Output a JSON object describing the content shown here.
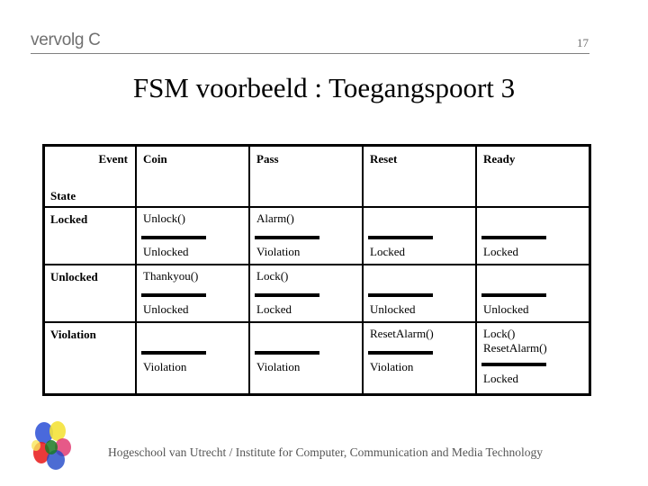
{
  "header": {
    "section": "vervolg C",
    "page_number": "17"
  },
  "title": "FSM voorbeeld : Toegangspoort 3",
  "table": {
    "corner": {
      "event_label": "Event",
      "state_label": "State"
    },
    "events": [
      "Coin",
      "Pass",
      "Reset",
      "Ready"
    ],
    "rows": [
      {
        "state": "Locked",
        "cells": [
          {
            "actions": [
              "Unlock()"
            ],
            "next": "Unlocked"
          },
          {
            "actions": [
              "Alarm()"
            ],
            "next": "Violation"
          },
          {
            "actions": [],
            "next": "Locked"
          },
          {
            "actions": [],
            "next": "Locked"
          }
        ]
      },
      {
        "state": "Unlocked",
        "cells": [
          {
            "actions": [
              "Thankyou()"
            ],
            "next": "Unlocked"
          },
          {
            "actions": [
              "Lock()"
            ],
            "next": "Locked"
          },
          {
            "actions": [],
            "next": "Unlocked"
          },
          {
            "actions": [],
            "next": "Unlocked"
          }
        ]
      },
      {
        "state": "Violation",
        "cells": [
          {
            "actions": [],
            "next": "Violation"
          },
          {
            "actions": [],
            "next": "Violation"
          },
          {
            "actions": [
              "ResetAlarm()"
            ],
            "next": "Violation"
          },
          {
            "actions": [
              "Lock()",
              "ResetAlarm()"
            ],
            "next": "Locked"
          }
        ]
      }
    ]
  },
  "footer": {
    "text": "Hogeschool van Utrecht / Institute for Computer, Communication and Media Technology",
    "logo_icon": "hu-flower-logo-icon"
  }
}
